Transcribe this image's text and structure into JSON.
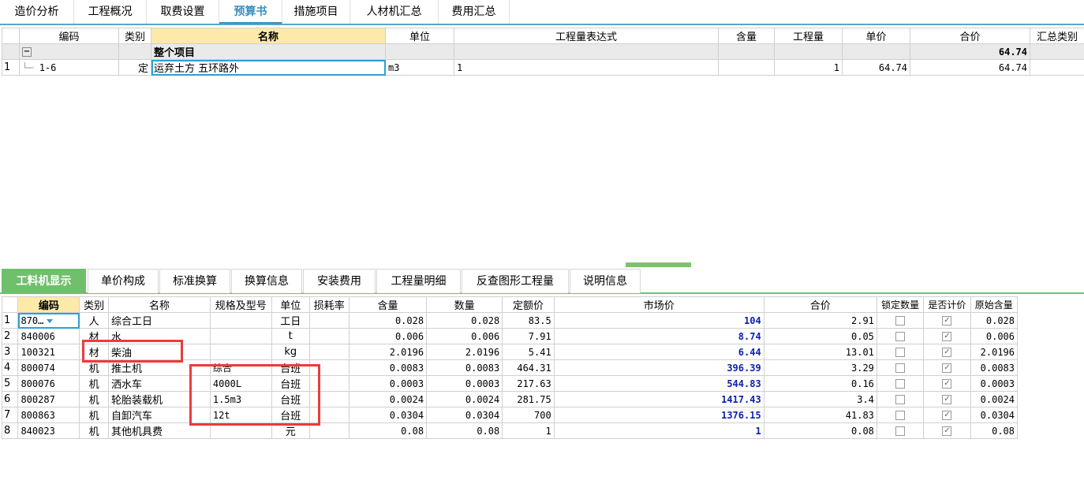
{
  "top_tabs": [
    "造价分析",
    "工程概况",
    "取费设置",
    "预算书",
    "措施项目",
    "人材机汇总",
    "费用汇总"
  ],
  "top_active": "预算书",
  "upper_table": {
    "headers": [
      "编码",
      "类别",
      "名称",
      "单位",
      "工程量表达式",
      "含量",
      "工程量",
      "单价",
      "合价",
      "汇总类别"
    ],
    "group_row": {
      "name": "整个项目",
      "total": "64.74"
    },
    "rows": [
      {
        "num": "1",
        "code": "1-6",
        "type": "定",
        "name": "运弃土方 五环路外",
        "unit": "m3",
        "expr": "1",
        "content": "",
        "qty": "1",
        "price": "64.74",
        "total": "64.74",
        "summary": ""
      }
    ]
  },
  "bottom_tabs": [
    "工料机显示",
    "单价构成",
    "标准换算",
    "换算信息",
    "安装费用",
    "工程量明细",
    "反查图形工程量",
    "说明信息"
  ],
  "bottom_active": "工料机显示",
  "lower_table": {
    "headers": [
      "编码",
      "类别",
      "名称",
      "规格及型号",
      "单位",
      "损耗率",
      "含量",
      "数量",
      "定额价",
      "市场价",
      "合价",
      "锁定数量",
      "是否计价",
      "原始含量"
    ],
    "rows": [
      {
        "num": "1",
        "code": "870…",
        "type": "人",
        "name": "综合工日",
        "spec": "",
        "unit": "工日",
        "loss": "",
        "content": "0.028",
        "qty": "0.028",
        "quota": "83.5",
        "market": "104",
        "total": "2.91",
        "orig": "0.028"
      },
      {
        "num": "2",
        "code": "840006",
        "type": "材",
        "name": "水",
        "spec": "",
        "unit": "t",
        "loss": "",
        "content": "0.006",
        "qty": "0.006",
        "quota": "7.91",
        "market": "8.74",
        "total": "0.05",
        "orig": "0.006"
      },
      {
        "num": "3",
        "code": "100321",
        "type": "材",
        "name": "柴油",
        "spec": "",
        "unit": "kg",
        "loss": "",
        "content": "2.0196",
        "qty": "2.0196",
        "quota": "5.41",
        "market": "6.44",
        "total": "13.01",
        "orig": "2.0196"
      },
      {
        "num": "4",
        "code": "800074",
        "type": "机",
        "name": "推土机",
        "spec": "综合",
        "unit": "台班",
        "loss": "",
        "content": "0.0083",
        "qty": "0.0083",
        "quota": "464.31",
        "market": "396.39",
        "total": "3.29",
        "orig": "0.0083"
      },
      {
        "num": "5",
        "code": "800076",
        "type": "机",
        "name": "洒水车",
        "spec": "4000L",
        "unit": "台班",
        "loss": "",
        "content": "0.0003",
        "qty": "0.0003",
        "quota": "217.63",
        "market": "544.83",
        "total": "0.16",
        "orig": "0.0003"
      },
      {
        "num": "6",
        "code": "800287",
        "type": "机",
        "name": "轮胎装载机",
        "spec": "1.5m3",
        "unit": "台班",
        "loss": "",
        "content": "0.0024",
        "qty": "0.0024",
        "quota": "281.75",
        "market": "1417.43",
        "total": "3.4",
        "orig": "0.0024"
      },
      {
        "num": "7",
        "code": "800863",
        "type": "机",
        "name": "自卸汽车",
        "spec": "12t",
        "unit": "台班",
        "loss": "",
        "content": "0.0304",
        "qty": "0.0304",
        "quota": "700",
        "market": "1376.15",
        "total": "41.83",
        "orig": "0.0304"
      },
      {
        "num": "8",
        "code": "840023",
        "type": "机",
        "name": "其他机具费",
        "spec": "",
        "unit": "元",
        "loss": "",
        "content": "0.08",
        "qty": "0.08",
        "quota": "1",
        "market": "1",
        "total": "0.08",
        "orig": "0.08"
      }
    ]
  },
  "colors": {
    "active_tab": "#3a8fc0",
    "bottom_active_tab": "#6fbf6b",
    "market_price": "#0b1fb0",
    "annotation": "#ec3b3b"
  }
}
